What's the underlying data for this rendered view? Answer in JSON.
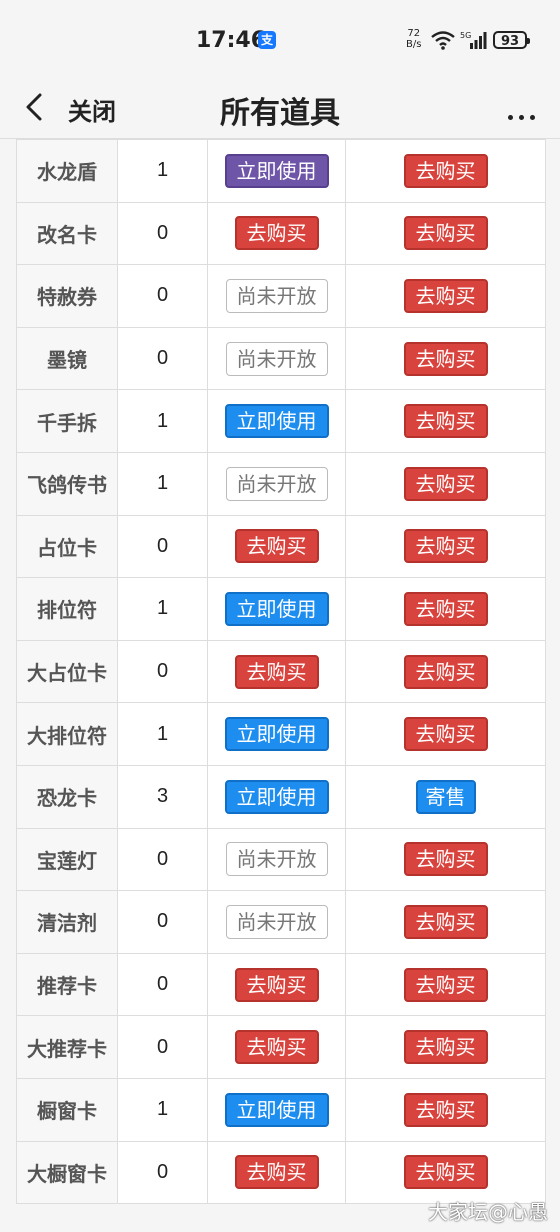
{
  "status": {
    "time": "17:46",
    "alipay_glyph": "支",
    "net_speed_value": "72",
    "net_speed_unit": "B/s",
    "battery": "93"
  },
  "nav": {
    "close_label": "关闭",
    "title": "所有道具"
  },
  "rows": [
    {
      "name": "水龙盾",
      "count": "1",
      "action": "立即使用",
      "action_type": "use-purple",
      "buy": "去购买",
      "buy_type": "buy"
    },
    {
      "name": "改名卡",
      "count": "0",
      "action": "去购买",
      "action_type": "buy",
      "buy": "去购买",
      "buy_type": "buy"
    },
    {
      "name": "特赦券",
      "count": "0",
      "action": "尚未开放",
      "action_type": "closed",
      "buy": "去购买",
      "buy_type": "buy"
    },
    {
      "name": "墨镜",
      "count": "0",
      "action": "尚未开放",
      "action_type": "closed",
      "buy": "去购买",
      "buy_type": "buy"
    },
    {
      "name": "千手拆",
      "count": "1",
      "action": "立即使用",
      "action_type": "use",
      "buy": "去购买",
      "buy_type": "buy"
    },
    {
      "name": "飞鸽传书",
      "count": "1",
      "action": "尚未开放",
      "action_type": "closed",
      "buy": "去购买",
      "buy_type": "buy"
    },
    {
      "name": "占位卡",
      "count": "0",
      "action": "去购买",
      "action_type": "buy",
      "buy": "去购买",
      "buy_type": "buy"
    },
    {
      "name": "排位符",
      "count": "1",
      "action": "立即使用",
      "action_type": "use",
      "buy": "去购买",
      "buy_type": "buy"
    },
    {
      "name": "大占位卡",
      "count": "0",
      "action": "去购买",
      "action_type": "buy",
      "buy": "去购买",
      "buy_type": "buy"
    },
    {
      "name": "大排位符",
      "count": "1",
      "action": "立即使用",
      "action_type": "use",
      "buy": "去购买",
      "buy_type": "buy"
    },
    {
      "name": "恐龙卡",
      "count": "3",
      "action": "立即使用",
      "action_type": "use",
      "buy": "寄售",
      "buy_type": "sell"
    },
    {
      "name": "宝莲灯",
      "count": "0",
      "action": "尚未开放",
      "action_type": "closed",
      "buy": "去购买",
      "buy_type": "buy"
    },
    {
      "name": "清洁剂",
      "count": "0",
      "action": "尚未开放",
      "action_type": "closed",
      "buy": "去购买",
      "buy_type": "buy"
    },
    {
      "name": "推荐卡",
      "count": "0",
      "action": "去购买",
      "action_type": "buy",
      "buy": "去购买",
      "buy_type": "buy"
    },
    {
      "name": "大推荐卡",
      "count": "0",
      "action": "去购买",
      "action_type": "buy",
      "buy": "去购买",
      "buy_type": "buy"
    },
    {
      "name": "橱窗卡",
      "count": "1",
      "action": "立即使用",
      "action_type": "use",
      "buy": "去购买",
      "buy_type": "buy"
    },
    {
      "name": "大橱窗卡",
      "count": "0",
      "action": "去购买",
      "action_type": "buy",
      "buy": "去购买",
      "buy_type": "buy"
    }
  ],
  "watermark": "大家坛@心愚",
  "colors": {
    "buy": "#d9433d",
    "use": "#1d8ef0",
    "use_purple": "#6f55a8"
  },
  "icons": [
    "back-chevron-icon",
    "more-dots-icon",
    "wifi-icon",
    "signal-icon",
    "battery-icon",
    "alipay-icon"
  ]
}
